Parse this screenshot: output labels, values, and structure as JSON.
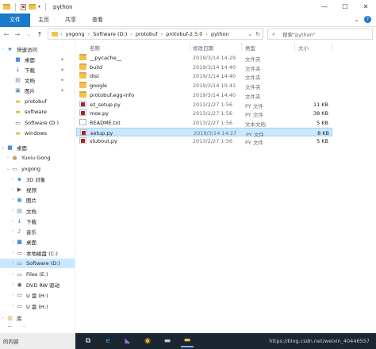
{
  "titlebar": {
    "title": "python",
    "controls": {
      "minimize": "—",
      "maximize": "☐",
      "close": "✕"
    }
  },
  "ribbon": {
    "tabs": [
      "文件",
      "主页",
      "共享",
      "查看"
    ],
    "right_icons": [
      "chevron-down-icon",
      "help-icon"
    ]
  },
  "address": {
    "back": "←",
    "forward": "→",
    "up_dropdown": "⌄",
    "up": "↑",
    "crumbs": [
      "yxgong",
      "Software (D:)",
      "protobuf",
      "protobuf-2.5.0",
      "python"
    ],
    "crumb_separator": "›",
    "refresh": "↻",
    "dropdown": "⌄"
  },
  "search": {
    "placeholder": "搜索\"python\""
  },
  "navpane": {
    "items": [
      {
        "label": "快速访问",
        "icon": "star-icon",
        "glyph": "★",
        "color": "#3a86d6",
        "expand": "›",
        "pinned": false
      },
      {
        "label": "桌面",
        "icon": "desktop-icon",
        "glyph": "■",
        "color": "#4a8fd8",
        "expand": "",
        "pinned": true
      },
      {
        "label": "下载",
        "icon": "download-icon",
        "glyph": "↓",
        "color": "#2f7ad0",
        "expand": "",
        "pinned": true
      },
      {
        "label": "文档",
        "icon": "documents-icon",
        "glyph": "▤",
        "color": "#6b7f99",
        "expand": "",
        "pinned": true
      },
      {
        "label": "图片",
        "icon": "pictures-icon",
        "glyph": "▣",
        "color": "#4a90c8",
        "expand": "",
        "pinned": true
      },
      {
        "label": "protobuf",
        "icon": "folder-icon",
        "glyph": "▬",
        "color": "#e8b84a",
        "expand": "",
        "pinned": false
      },
      {
        "label": "software",
        "icon": "folder-icon",
        "glyph": "▬",
        "color": "#e8b84a",
        "expand": "",
        "pinned": false
      },
      {
        "label": "Software (D:)",
        "icon": "drive-icon",
        "glyph": "▭",
        "color": "#555555",
        "expand": "",
        "pinned": false
      },
      {
        "label": "windows",
        "icon": "folder-icon",
        "glyph": "▬",
        "color": "#e8b84a",
        "expand": "",
        "pinned": false
      },
      {
        "label": "桌面",
        "icon": "desktop-icon",
        "glyph": "■",
        "color": "#4a8fd8",
        "expand": "⌄",
        "pinned": false
      },
      {
        "label": "Yuxiu Gong",
        "icon": "user-icon",
        "glyph": "●",
        "color": "#c9a36b",
        "expand": "›",
        "pinned": false
      },
      {
        "label": "yxgong",
        "icon": "computer-icon",
        "glyph": "▭",
        "color": "#3f7cc4",
        "expand": "⌄",
        "pinned": false
      },
      {
        "label": "3D 对象",
        "icon": "3d-objects-icon",
        "glyph": "◆",
        "color": "#4aa3df",
        "expand": "›",
        "pinned": false
      },
      {
        "label": "视频",
        "icon": "video-icon",
        "glyph": "▶",
        "color": "#555555",
        "expand": "›",
        "pinned": false
      },
      {
        "label": "图片",
        "icon": "pictures-icon",
        "glyph": "▣",
        "color": "#4a90c8",
        "expand": "›",
        "pinned": false
      },
      {
        "label": "文档",
        "icon": "documents-icon",
        "glyph": "▤",
        "color": "#6b7f99",
        "expand": "›",
        "pinned": false
      },
      {
        "label": "下载",
        "icon": "download-icon",
        "glyph": "↓",
        "color": "#2f7ad0",
        "expand": "›",
        "pinned": false
      },
      {
        "label": "音乐",
        "icon": "music-icon",
        "glyph": "♪",
        "color": "#2f7ad0",
        "expand": "›",
        "pinned": false
      },
      {
        "label": "桌面",
        "icon": "desktop-icon",
        "glyph": "■",
        "color": "#4a8fd8",
        "expand": "›",
        "pinned": false
      },
      {
        "label": "本地磁盘 (C:)",
        "icon": "drive-icon",
        "glyph": "▭",
        "color": "#555555",
        "expand": "›",
        "pinned": false
      },
      {
        "label": "Software (D:)",
        "icon": "drive-icon",
        "glyph": "▭",
        "color": "#555555",
        "expand": "›",
        "pinned": false,
        "selected": true
      },
      {
        "label": "Files (E:)",
        "icon": "drive-icon",
        "glyph": "▭",
        "color": "#555555",
        "expand": "›",
        "pinned": false
      },
      {
        "label": "DVD RW 驱动",
        "icon": "dvd-drive-icon",
        "glyph": "◉",
        "color": "#555555",
        "expand": "›",
        "pinned": false
      },
      {
        "label": "U 盘 (H:)",
        "icon": "usb-drive-icon",
        "glyph": "▭",
        "color": "#555555",
        "expand": "›",
        "pinned": false
      },
      {
        "label": "U 盘 (H:)",
        "icon": "usb-drive-icon",
        "glyph": "▭",
        "color": "#555555",
        "expand": "›",
        "pinned": false
      },
      {
        "label": "库",
        "icon": "library-icon",
        "glyph": "▥",
        "color": "#d6a23a",
        "expand": "›",
        "pinned": false
      },
      {
        "label": "网络",
        "icon": "network-icon",
        "glyph": "◧",
        "color": "#3f7cc4",
        "expand": "›",
        "pinned": false
      }
    ]
  },
  "columns": {
    "name": "名称",
    "date": "修改日期",
    "type": "类型",
    "size": "大小",
    "sort_indicator": "^"
  },
  "files": [
    {
      "name": "__pycache__",
      "date": "2019/3/14 14:29",
      "type": "文件夹",
      "size": "",
      "kind": "folder"
    },
    {
      "name": "build",
      "date": "2019/3/14 14:40",
      "type": "文件夹",
      "size": "",
      "kind": "folder"
    },
    {
      "name": "dist",
      "date": "2019/3/14 14:40",
      "type": "文件夹",
      "size": "",
      "kind": "folder"
    },
    {
      "name": "google",
      "date": "2019/3/14 10:41",
      "type": "文件夹",
      "size": "",
      "kind": "folder"
    },
    {
      "name": "protobuf.egg-info",
      "date": "2019/3/14 14:40",
      "type": "文件夹",
      "size": "",
      "kind": "folder"
    },
    {
      "name": "ez_setup.py",
      "date": "2013/2/27 1:56",
      "type": "PY 文件",
      "size": "11 KB",
      "kind": "py"
    },
    {
      "name": "mox.py",
      "date": "2013/2/27 1:56",
      "type": "PY 文件",
      "size": "38 KB",
      "kind": "py"
    },
    {
      "name": "README.txt",
      "date": "2013/2/27 1:56",
      "type": "文本文档",
      "size": "5 KB",
      "kind": "txt"
    },
    {
      "name": "setup.py",
      "date": "2019/3/14 14:27",
      "type": "PY 文件",
      "size": "8 KB",
      "kind": "py",
      "selected": true
    },
    {
      "name": "stubout.py",
      "date": "2013/2/27 1:56",
      "type": "PY 文件",
      "size": "5 KB",
      "kind": "py"
    }
  ],
  "taskbar": {
    "search_text": "的内容",
    "icons": [
      {
        "name": "task-view-icon",
        "glyph": "⧉",
        "color": "#ffffff"
      },
      {
        "name": "edge-icon",
        "glyph": "e",
        "color": "#3aa0f0"
      },
      {
        "name": "visual-studio-icon",
        "glyph": "◣",
        "color": "#a66bd6"
      },
      {
        "name": "chrome-icon",
        "glyph": "◉",
        "color": "#f2b632"
      },
      {
        "name": "terminal-icon",
        "glyph": "▬",
        "color": "#cccccc"
      },
      {
        "name": "file-explorer-icon",
        "glyph": "▬",
        "color": "#f1c34e"
      }
    ],
    "watermark": "https://blog.csdn.net/weixin_40446557"
  },
  "colors": {
    "accent": "#1979ca",
    "selection": "#cce8ff",
    "folder": "#f1c34e",
    "taskbar": "#1b2631"
  }
}
